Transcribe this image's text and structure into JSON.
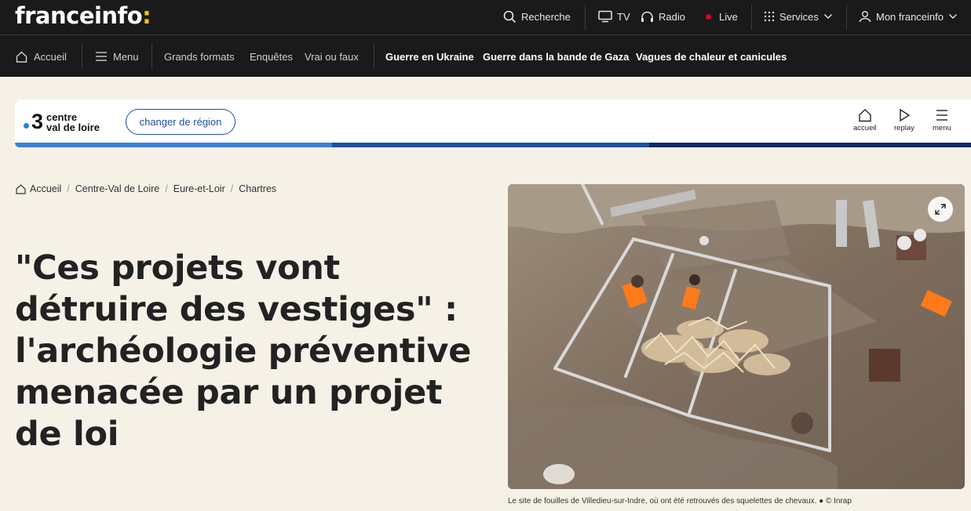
{
  "header": {
    "logo_text": "franceinfo",
    "logo_colon": ":",
    "search_label": "Recherche",
    "tv_label": "TV",
    "radio_label": "Radio",
    "live_label": "Live",
    "services_label": "Services",
    "account_label": "Mon franceinfo",
    "accent_color": "#f6c400",
    "live_color": "#e2001a"
  },
  "nav": {
    "home_label": "Accueil",
    "menu_label": "Menu",
    "links": [
      "Grands formats",
      "Enquêtes",
      "Vrai ou faux"
    ],
    "topics": [
      "Guerre en Ukraine",
      "Guerre dans la bande de Gaza",
      "Vagues de chaleur et canicules"
    ]
  },
  "region": {
    "channel_number": "3",
    "name_line1": "centre",
    "name_line2": "val de loire",
    "change_button": "changer de région",
    "icons": [
      {
        "icon": "home-icon",
        "label": "accueil"
      },
      {
        "icon": "play-icon",
        "label": "replay"
      },
      {
        "icon": "hamburger-icon",
        "label": "menu"
      }
    ]
  },
  "breadcrumb": [
    "Accueil",
    "Centre-Val de Loire",
    "Eure-et-Loir",
    "Chartres"
  ],
  "article": {
    "title": "\"Ces projets vont détruire des vestiges\" : l'archéologie préventive menacée par un projet de loi",
    "caption": "Le site de fouilles de Villedieu-sur-Indre, où ont été retrouvés des squelettes de chevaux. ● © Inrap"
  }
}
